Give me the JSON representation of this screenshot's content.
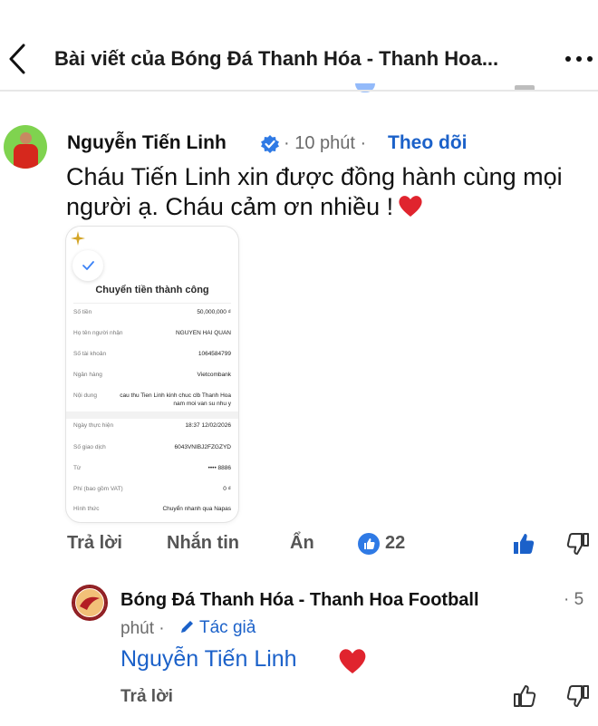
{
  "header": {
    "title": "Bài viết của Bóng Đá Thanh Hóa - Thanh Hoa...",
    "back_icon": "chevron-left-icon",
    "more_icon": "more-horizontal-icon"
  },
  "comment": {
    "author": "Nguyễn Tiến Linh",
    "verified_icon": "verified-badge-icon",
    "time": "· 10 phút ·",
    "follow": "Theo dõi",
    "text": "Cháu Tiến Linh xin được đồng hành cùng mọi người ạ. Cháu cảm ơn nhiều !",
    "emoji": "heart"
  },
  "receipt": {
    "title": "Chuyển tiền thành công",
    "rows": [
      {
        "label": "Số tiền",
        "value": "50,000,000 ₫"
      },
      {
        "label": "Họ tên người nhận",
        "value": "NGUYEN HAI QUAN"
      },
      {
        "label": "Số tài khoản",
        "value": "1064584799"
      },
      {
        "label": "Ngân hàng",
        "value": "Vietcombank"
      },
      {
        "label": "Nội dung",
        "value": "cau thu Tien Linh kinh chuc clb Thanh Hoa"
      },
      {
        "label": "",
        "value": "nam moi van su nhu y"
      },
      {
        "label": "Ngày thực hiện",
        "value": "18:37 12/02/2026"
      },
      {
        "label": "Số giao dịch",
        "value": "6043VNIBJ2FZGZYD"
      },
      {
        "label": "Từ",
        "value": "•••• 8886"
      },
      {
        "label": "Phí (bao gồm VAT)",
        "value": "0 ₫"
      },
      {
        "label": "Hình thức",
        "value": "Chuyển nhanh qua Napas"
      }
    ]
  },
  "actions": {
    "reply": "Trả lời",
    "message": "Nhắn tin",
    "hide": "Ẩn",
    "like_count": "22"
  },
  "reply": {
    "author": "Bóng Đá Thanh Hóa - Thanh Hoa Football",
    "time_part1": "· 5",
    "time_part2": "phút ·",
    "author_tag": "Tác giả",
    "mention": "Nguyễn Tiến Linh",
    "reply_label": "Trả lời"
  },
  "colors": {
    "accent_blue": "#1b61c9",
    "like_blue": "#2f7ae5",
    "heart_red": "#e0242e"
  }
}
